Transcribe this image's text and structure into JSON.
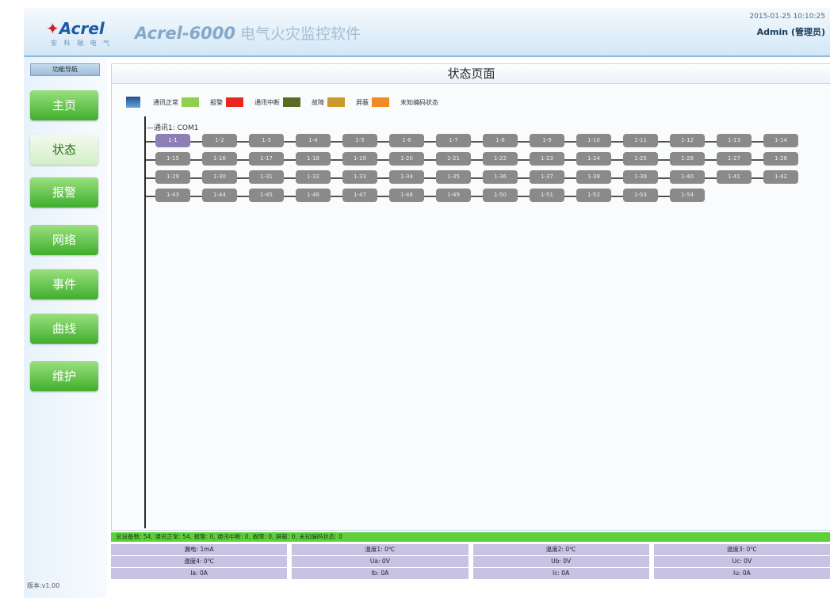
{
  "header": {
    "logo_text": "Acrel",
    "logo_sub": "安 科 瑞 电 气",
    "app_title": "Acrel-6000",
    "app_title_cn": "电气火灾监控软件",
    "datetime": "2015-01-25 10:10:25",
    "user": "Admin (管理员)"
  },
  "sidebar": {
    "menu_header": "功能导航",
    "items": [
      {
        "label": "主页"
      },
      {
        "label": "状态"
      },
      {
        "label": "报警"
      },
      {
        "label": "网络"
      },
      {
        "label": "事件"
      },
      {
        "label": "曲线"
      },
      {
        "label": "维护"
      }
    ],
    "version": "版本:v1.00"
  },
  "page_title": "状态页面",
  "legend": [
    {
      "label": "通讯正常",
      "color": "#8fd14f"
    },
    {
      "label": "报警",
      "color": "#e8281f"
    },
    {
      "label": "通讯中断",
      "color": "#5c6a22"
    },
    {
      "label": "故障",
      "color": "#c99a2a"
    },
    {
      "label": "屏蔽",
      "color": "#f08a24"
    },
    {
      "label": "未知编码状态",
      "color": ""
    }
  ],
  "comm_label": "—通讯1: COM1",
  "device_rows": [
    [
      "1-1",
      "1-2",
      "1-3",
      "1-4",
      "1-5",
      "1-6",
      "1-7",
      "1-8",
      "1-9",
      "1-10",
      "1-11",
      "1-12",
      "1-13",
      "1-14"
    ],
    [
      "1-15",
      "1-16",
      "1-17",
      "1-18",
      "1-19",
      "1-20",
      "1-21",
      "1-22",
      "1-23",
      "1-24",
      "1-25",
      "1-26",
      "1-27",
      "1-28"
    ],
    [
      "1-29",
      "1-30",
      "1-31",
      "1-32",
      "1-33",
      "1-34",
      "1-35",
      "1-36",
      "1-37",
      "1-38",
      "1-39",
      "1-40",
      "1-41",
      "1-42"
    ],
    [
      "1-43",
      "1-44",
      "1-45",
      "1-46",
      "1-47",
      "1-48",
      "1-49",
      "1-50",
      "1-51",
      "1-52",
      "1-53",
      "1-54"
    ]
  ],
  "status_message": "总设备数: 54, 通讯正常: 54, 报警: 0, 通讯中断: 0, 故障: 0, 屏蔽: 0, 未知编码状态: 0",
  "stats": [
    "漏电: 1mA",
    "温度1: 0℃",
    "温度2: 0℃",
    "温度3: 0℃",
    "温度4: 0℃",
    "Ua: 0V",
    "Ub: 0V",
    "Uc: 0V",
    "Ia: 0A",
    "Ib: 0A",
    "Ic: 0A",
    "Iu: 0A"
  ]
}
